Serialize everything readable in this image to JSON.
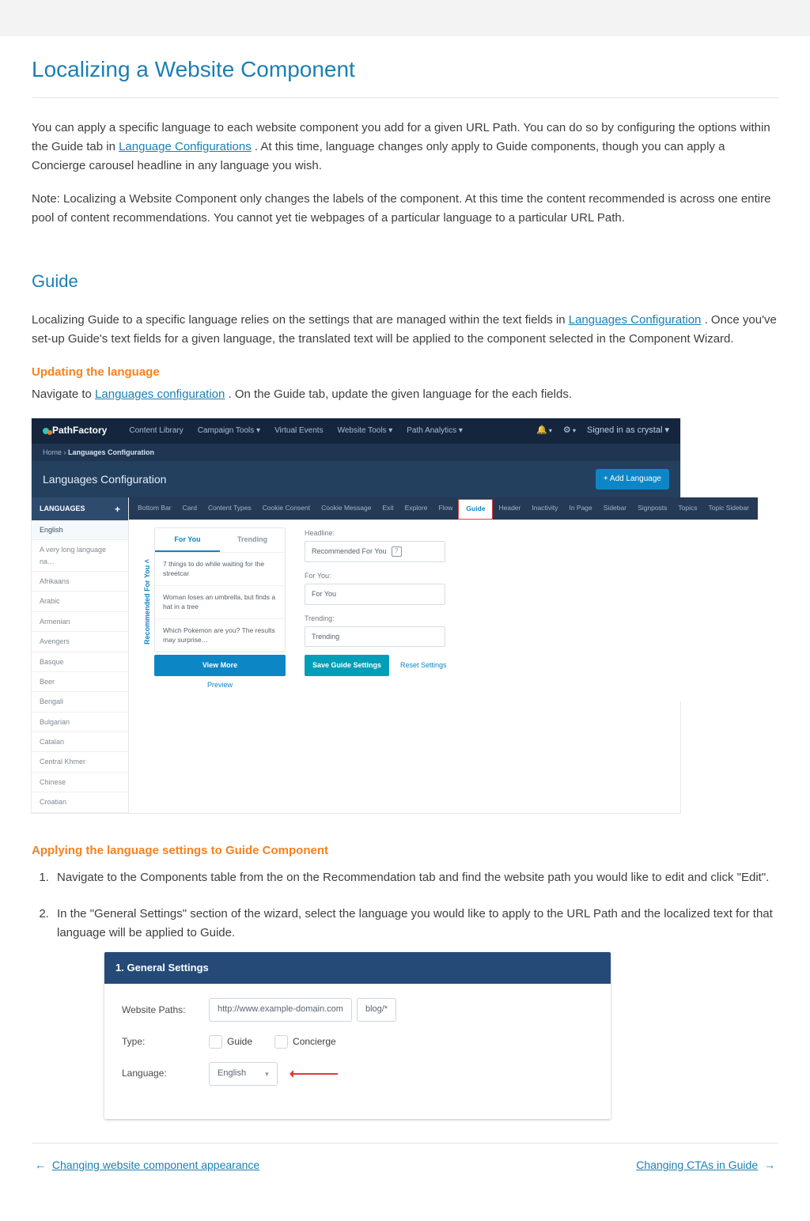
{
  "title": "Localizing a Website Component",
  "intro": {
    "p1a": "You can apply a specific language to each website component you add for a given URL Path. You can do so by configuring the options within the Guide tab in ",
    "p1link": "Language Configurations",
    "p1b": ". At this time, language changes only apply to Guide components, though you can apply a Concierge carousel headline in any language you wish.",
    "p2": "Note: Localizing a Website Component only changes the labels of the component. At this time the content recommended is across one entire pool of content recommendations. You cannot yet tie webpages of a particular language to a particular URL Path."
  },
  "guide": {
    "heading": "Guide",
    "p1a": "Localizing Guide to a specific language relies on the settings that are managed within the text fields in ",
    "p1link": "Languages Configuration",
    "p1b": ". Once you've set-up Guide's text fields for a given language, the translated text will be applied to the component selected in the Component Wizard."
  },
  "updating": {
    "heading": "Updating the language",
    "p_a": "Navigate to ",
    "p_link": "Languages configuration",
    "p_b": ". On the Guide tab, update the given language for the each fields."
  },
  "shot1": {
    "brand": "PathFactory",
    "nav": [
      "Content Library",
      "Campaign Tools ▾",
      "Virtual Events",
      "Website Tools ▾",
      "Path Analytics ▾"
    ],
    "nav_right": {
      "bell": "🔔",
      "gear": "⚙",
      "signed": "Signed in as crystal ▾"
    },
    "crumb_a": "Home › ",
    "crumb_b": "Languages Configuration",
    "lc_title": "Languages Configuration",
    "add_lang": "+ Add Language",
    "lang_header": "LANGUAGES",
    "languages": [
      "English",
      "A very long language na…",
      "Afrikaans",
      "Arabic",
      "Armenian",
      "Avengers",
      "Basque",
      "Beer",
      "Bengali",
      "Bulgarian",
      "Catalan",
      "Central Khmer",
      "Chinese",
      "Croatian"
    ],
    "tabs": [
      "Bottom Bar",
      "Card",
      "Content Types",
      "Cookie Consent",
      "Cookie Message",
      "Exit",
      "Explore",
      "Flow",
      "Guide",
      "Header",
      "Inactivity",
      "In Page",
      "Sidebar",
      "Signposts",
      "Topics",
      "Topic Sidebar"
    ],
    "preview": {
      "side": "Recommended For You ˄",
      "for_you": "For You",
      "trending": "Trending",
      "rows": [
        "7 things to do while waiting for the streetcar",
        "Woman loses an umbrella, but finds a hat in a tree",
        "Which Pokemon are you? The results may surprise…"
      ],
      "view_more": "View More",
      "preview_link": "Preview"
    },
    "fields": {
      "headline_label": "Headline:",
      "headline_value": "Recommended For You",
      "foryou_label": "For You:",
      "foryou_value": "For You",
      "trending_label": "Trending:",
      "trending_value": "Trending",
      "save": "Save Guide Settings",
      "reset": "Reset Settings"
    }
  },
  "applying": {
    "heading": "Applying the language settings to Guide Component",
    "step1": "Navigate to the Components table from the on the Recommendation tab and find the website path you would like to edit and click \"Edit\".",
    "step2": "In the \"General Settings\" section of the wizard, select the language you would like to apply to the URL Path and the localized text for that language will be applied to Guide."
  },
  "shot2": {
    "head": "1. General Settings",
    "paths_label": "Website Paths:",
    "paths_domain": "http://www.example-domain.com",
    "paths_path": "blog/*",
    "type_label": "Type:",
    "type_guide": "Guide",
    "type_concierge": "Concierge",
    "lang_label": "Language:",
    "lang_value": "English"
  },
  "footer": {
    "prev": "Changing website component appearance",
    "next": "Changing CTAs in Guide"
  }
}
